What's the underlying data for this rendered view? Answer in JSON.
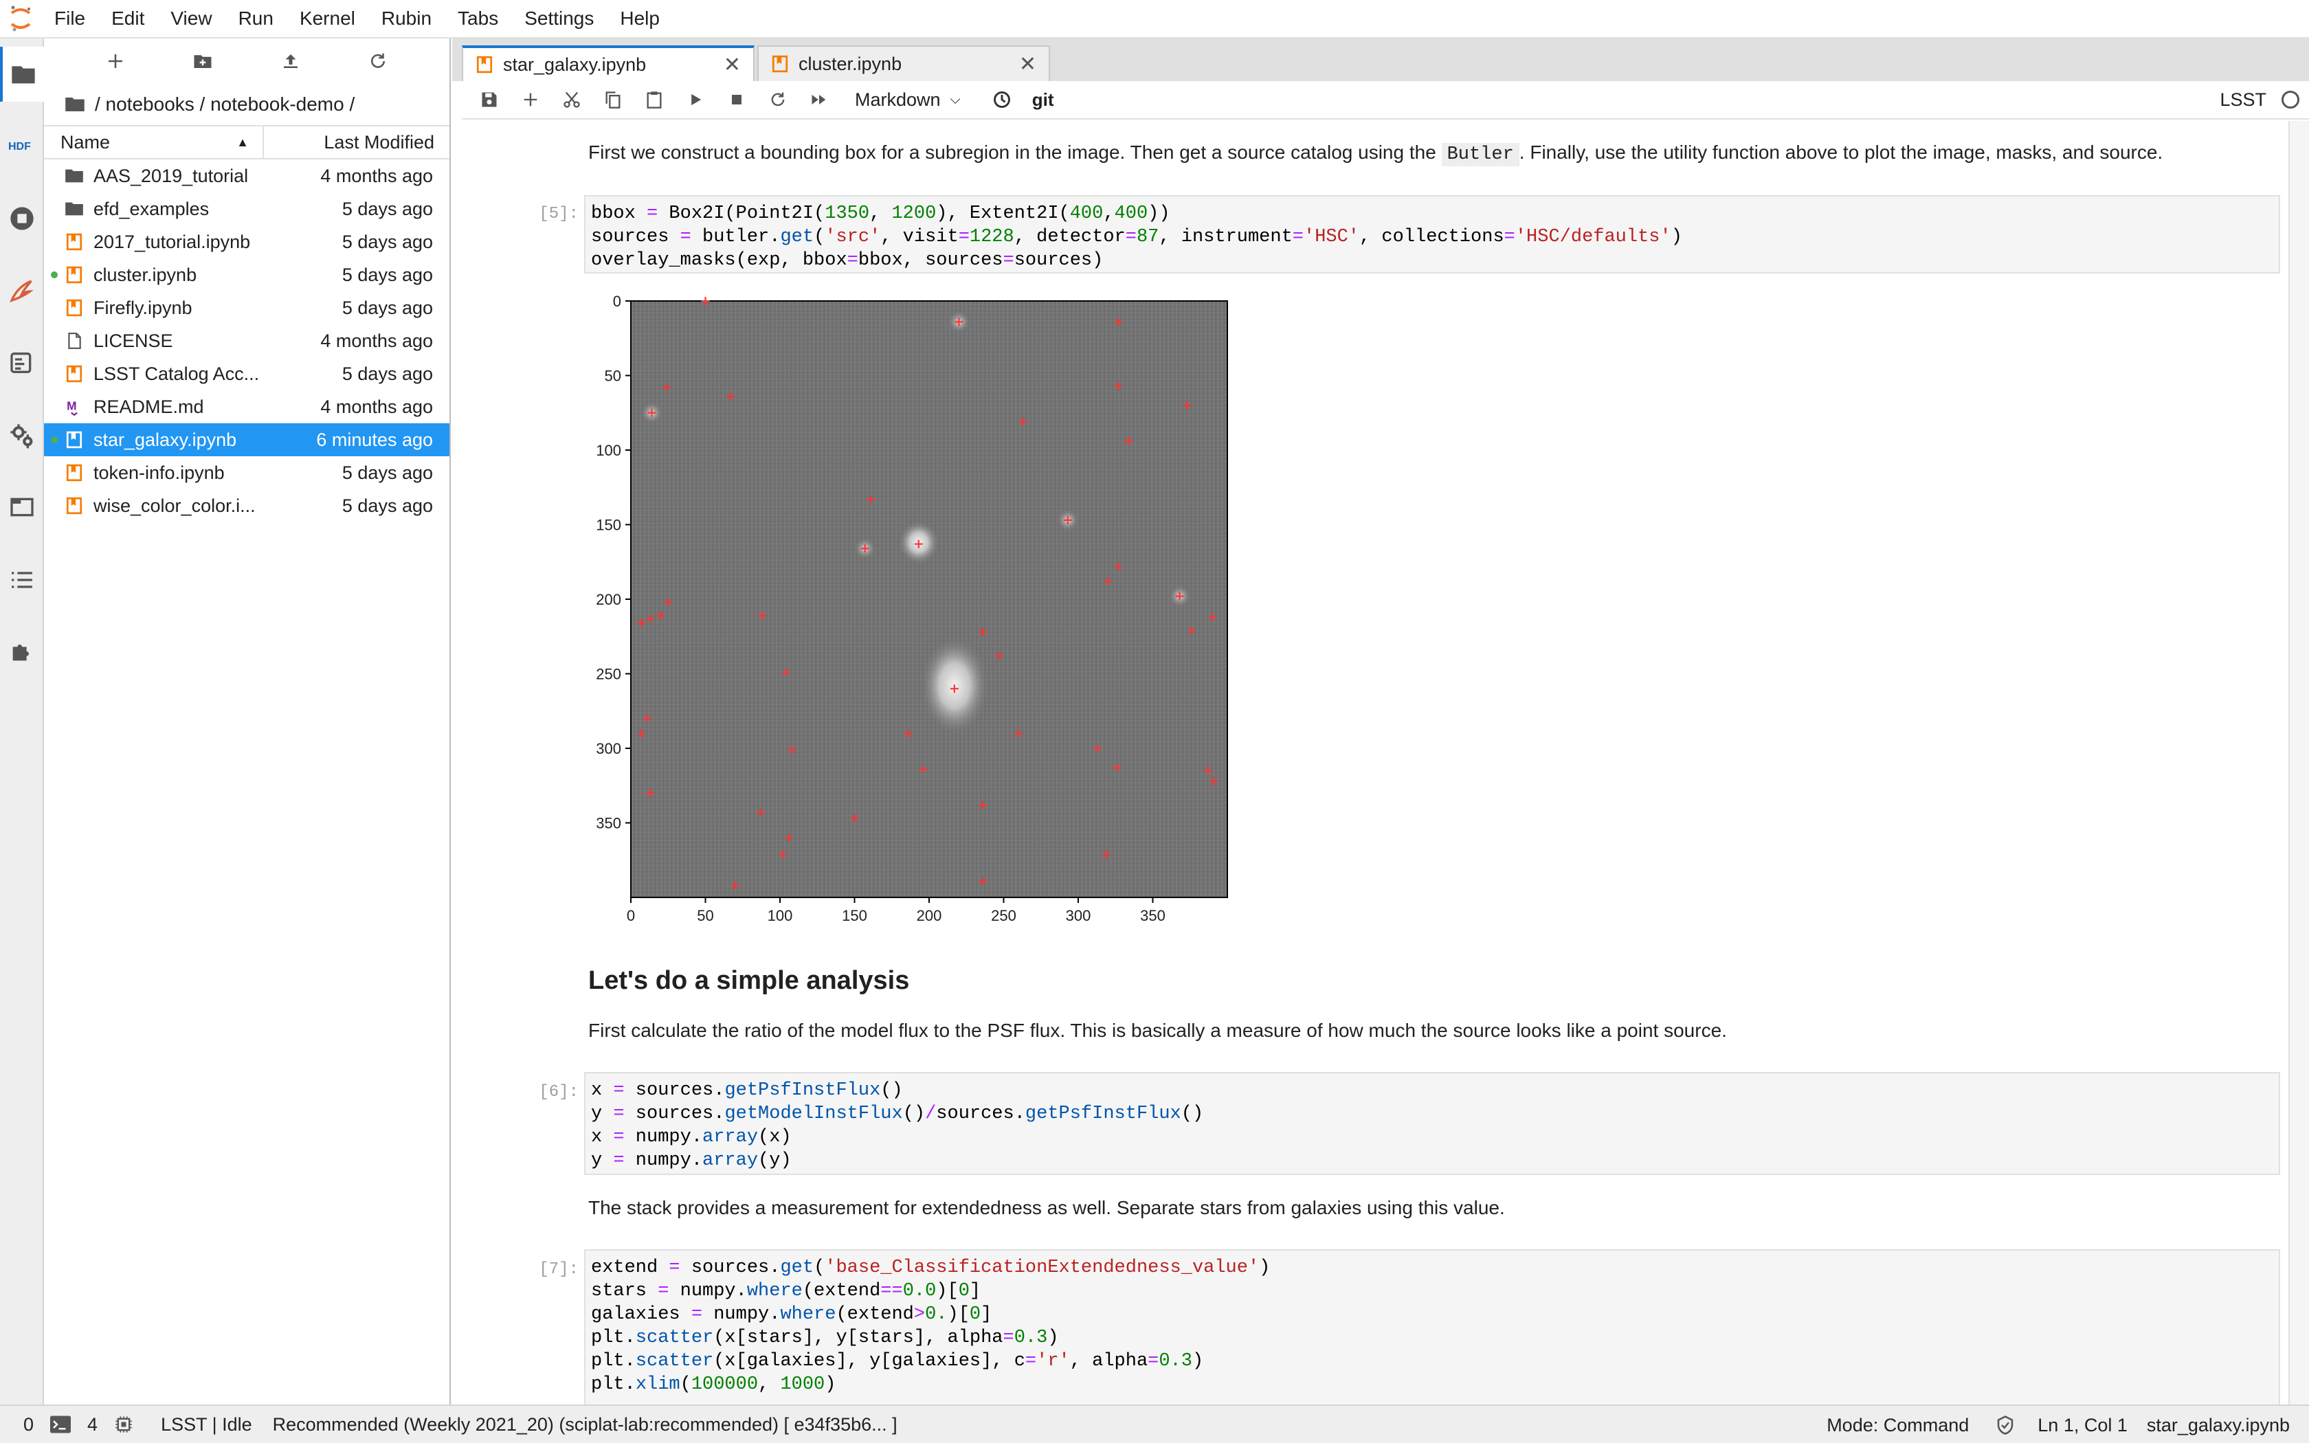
{
  "menubar": {
    "items": [
      "File",
      "Edit",
      "View",
      "Run",
      "Kernel",
      "Rubin",
      "Tabs",
      "Settings",
      "Help"
    ]
  },
  "activitybar": {
    "icons": [
      "folder-icon",
      "hdf-icon",
      "running-icon",
      "firefly-icon",
      "commands-icon",
      "property-inspector-icon",
      "tabs-icon",
      "toc-icon",
      "extension-icon"
    ]
  },
  "filebrowser": {
    "breadcrumb": "/ notebooks / notebook-demo /",
    "header": {
      "name": "Name",
      "modified": "Last Modified"
    },
    "files": [
      {
        "name": "AAS_2019_tutorial",
        "modified": "4 months ago",
        "type": "folder",
        "running": false,
        "selected": false
      },
      {
        "name": "efd_examples",
        "modified": "5 days ago",
        "type": "folder",
        "running": false,
        "selected": false
      },
      {
        "name": "2017_tutorial.ipynb",
        "modified": "5 days ago",
        "type": "notebook",
        "running": false,
        "selected": false
      },
      {
        "name": "cluster.ipynb",
        "modified": "5 days ago",
        "type": "notebook",
        "running": true,
        "selected": false
      },
      {
        "name": "Firefly.ipynb",
        "modified": "5 days ago",
        "type": "notebook",
        "running": false,
        "selected": false
      },
      {
        "name": "LICENSE",
        "modified": "4 months ago",
        "type": "file",
        "running": false,
        "selected": false
      },
      {
        "name": "LSST Catalog Acc...",
        "modified": "5 days ago",
        "type": "notebook",
        "running": false,
        "selected": false
      },
      {
        "name": "README.md",
        "modified": "4 months ago",
        "type": "markdown",
        "running": false,
        "selected": false
      },
      {
        "name": "star_galaxy.ipynb",
        "modified": "6 minutes ago",
        "type": "notebook",
        "running": true,
        "selected": true
      },
      {
        "name": "token-info.ipynb",
        "modified": "5 days ago",
        "type": "notebook",
        "running": false,
        "selected": false
      },
      {
        "name": "wise_color_color.i...",
        "modified": "5 days ago",
        "type": "notebook",
        "running": false,
        "selected": false
      }
    ]
  },
  "tabs": [
    {
      "label": "star_galaxy.ipynb",
      "active": true
    },
    {
      "label": "cluster.ipynb",
      "active": false
    }
  ],
  "nbtoolbar": {
    "cell_type": "Markdown",
    "git_label": "git",
    "kernel_name": "LSST"
  },
  "notebook": {
    "md1_before": "First we construct a bounding box for a subregion in the image. Then get a source catalog using the ",
    "md1_code": "Butler",
    "md1_after": ". Finally, use the utility function above to plot the image, masks, and source.",
    "prompt5": "[5]:",
    "heading": "Let's do a simple analysis",
    "md2": "First calculate the ratio of the model flux to the PSF flux. This is basically a measure of how much the source looks like a point source.",
    "prompt6": "[6]:",
    "md3": "The stack provides a measurement for extendedness as well. Separate stars from galaxies using this value.",
    "prompt7": "[7]:"
  },
  "chart_data": {
    "type": "image",
    "xticks": [
      "0",
      "50",
      "100",
      "150",
      "200",
      "250",
      "300",
      "350"
    ],
    "yticks": [
      "0",
      "50",
      "100",
      "150",
      "200",
      "250",
      "300",
      "350"
    ],
    "xlim": [
      0,
      400
    ],
    "ylim": [
      400,
      0
    ],
    "sources": [
      [
        50,
        0
      ],
      [
        220,
        14
      ],
      [
        327,
        14
      ],
      [
        14,
        75
      ],
      [
        24,
        58
      ],
      [
        67,
        64
      ],
      [
        327,
        57
      ],
      [
        373,
        70
      ],
      [
        263,
        81
      ],
      [
        334,
        94
      ],
      [
        161,
        133
      ],
      [
        293,
        147
      ],
      [
        157,
        166
      ],
      [
        193,
        163
      ],
      [
        327,
        178
      ],
      [
        320,
        188
      ],
      [
        368,
        198
      ],
      [
        390,
        212
      ],
      [
        7,
        216
      ],
      [
        13,
        213
      ],
      [
        20,
        211
      ],
      [
        25,
        202
      ],
      [
        88,
        211
      ],
      [
        236,
        222
      ],
      [
        376,
        221
      ],
      [
        247,
        238
      ],
      [
        104,
        249
      ],
      [
        217,
        260
      ],
      [
        11,
        280
      ],
      [
        7,
        290
      ],
      [
        186,
        290
      ],
      [
        260,
        290
      ],
      [
        108,
        301
      ],
      [
        313,
        300
      ],
      [
        196,
        314
      ],
      [
        326,
        313
      ],
      [
        387,
        315
      ],
      [
        391,
        322
      ],
      [
        13,
        330
      ],
      [
        236,
        338
      ],
      [
        87,
        343
      ],
      [
        150,
        347
      ],
      [
        102,
        371
      ],
      [
        106,
        360
      ],
      [
        319,
        371
      ],
      [
        236,
        389
      ],
      [
        70,
        392
      ]
    ]
  },
  "statusbar": {
    "terminals": "0",
    "kernels": "4",
    "kernel_status": "LSST | Idle",
    "image_info": "Recommended (Weekly 2021_20) (sciplat-lab:recommended) [ e34f35b6... ]",
    "mode": "Mode: Command",
    "position": "Ln 1, Col 1",
    "filename": "star_galaxy.ipynb"
  },
  "colors": {
    "accent": "#1976d2",
    "selected": "#2196f3",
    "notebook_icon": "#f57c00",
    "running_dot": "#4caf50",
    "source_marker": "#ff3333"
  }
}
